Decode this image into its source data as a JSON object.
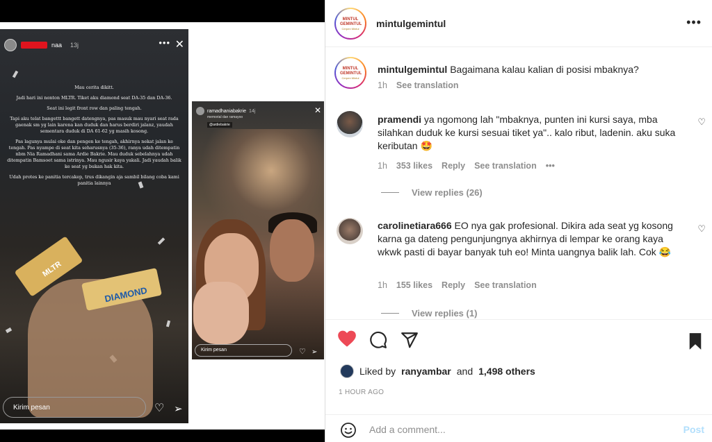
{
  "story_left": {
    "username": "naa",
    "time": "13j",
    "paragraphs": [
      "Mau cerita dikitt.",
      "Jadi hari ini nonton MLTR. Tiket aku diamond seat DA-35 dan DA-36.",
      "Seat ini legit front row dan paling tengah.",
      "Tapi aku telat bangettt bangett datengnya, pas masuk mau nyari seat rada gaenak sm yg lain karena kan duduk dan harus berdiri jalanz, yaudah sementara duduk di DA 61-62 yg masih kosong.",
      "Pas lagunya mulai oke dan pengen ke tengah, akhirnya nekat jalan ke tengah. Pas nyampe di seat kita seharusnya (35-36), ranya udah ditempatin nbm Nia Ramadhani sama Ardie Bakrie. Mau duduk sebelahnya udah ditempatin Bamsoet sama istrinya. Mau ngusir kaya yakali. Jadi yaudah balik ke seat yg bukan hak kita.",
      "Udah protes ke panitia tercakep, trus dikangin aja sambil bilang coba kami panitia lainnya"
    ],
    "wristband": "DIAMOND",
    "band_text": "MLTR",
    "reply_placeholder": "Kirim pesan"
  },
  "story_right": {
    "username": "ramadhaniabakrie",
    "time": "14j",
    "subtitle": "memorial dan ramayoo",
    "tag": "@ardiebakrie",
    "reply_placeholder": "Kirim pesan"
  },
  "post": {
    "author": "mintulgemintul",
    "logo_top": "MINTUL GEMINTUL",
    "logo_bottom": "Cerpen Mintul",
    "caption_text": "Bagaimana kalau kalian di posisi mbaknya?",
    "caption_time": "1h",
    "see_translation": "See translation"
  },
  "comments": [
    {
      "username": "pramendi",
      "text": "ya ngomong lah \"mbaknya, punten ini kursi saya, mba silahkan duduk ke kursi sesuai tiket ya\".. kalo ribut, ladenin. aku suka keributan 🤩",
      "time": "1h",
      "likes": "353 likes",
      "reply": "Reply",
      "see_translation": "See translation",
      "more": "•••",
      "view_replies": "View replies (26)"
    },
    {
      "username": "carolinetiara666",
      "text": "EO nya gak profesional. Dikira ada seat yg kosong karna ga dateng pengunjungnya akhirnya di lempar ke orang kaya wkwk pasti di bayar banyak tuh eo! Minta uangnya balik lah. Cok 😂",
      "time": "1h",
      "likes": "155 likes",
      "reply": "Reply",
      "see_translation": "See translation",
      "view_replies": "View replies (1)"
    }
  ],
  "likes_bar": {
    "prefix": "Liked by",
    "user": "ranyambar",
    "and": "and",
    "others": "1,498 others"
  },
  "time_ago": "1 HOUR AGO",
  "add_comment": {
    "placeholder": "Add a comment...",
    "post_label": "Post"
  },
  "colors": {
    "heart_liked": "#ed4956",
    "post_button_disabled": "#b2dffc",
    "redaction": "#e0141e"
  },
  "icons": {
    "like": "heart-filled-icon",
    "comment": "comment-bubble-icon",
    "share": "paper-plane-icon",
    "save": "bookmark-filled-icon",
    "emoji": "smiley-icon",
    "more": "ellipsis-icon"
  }
}
